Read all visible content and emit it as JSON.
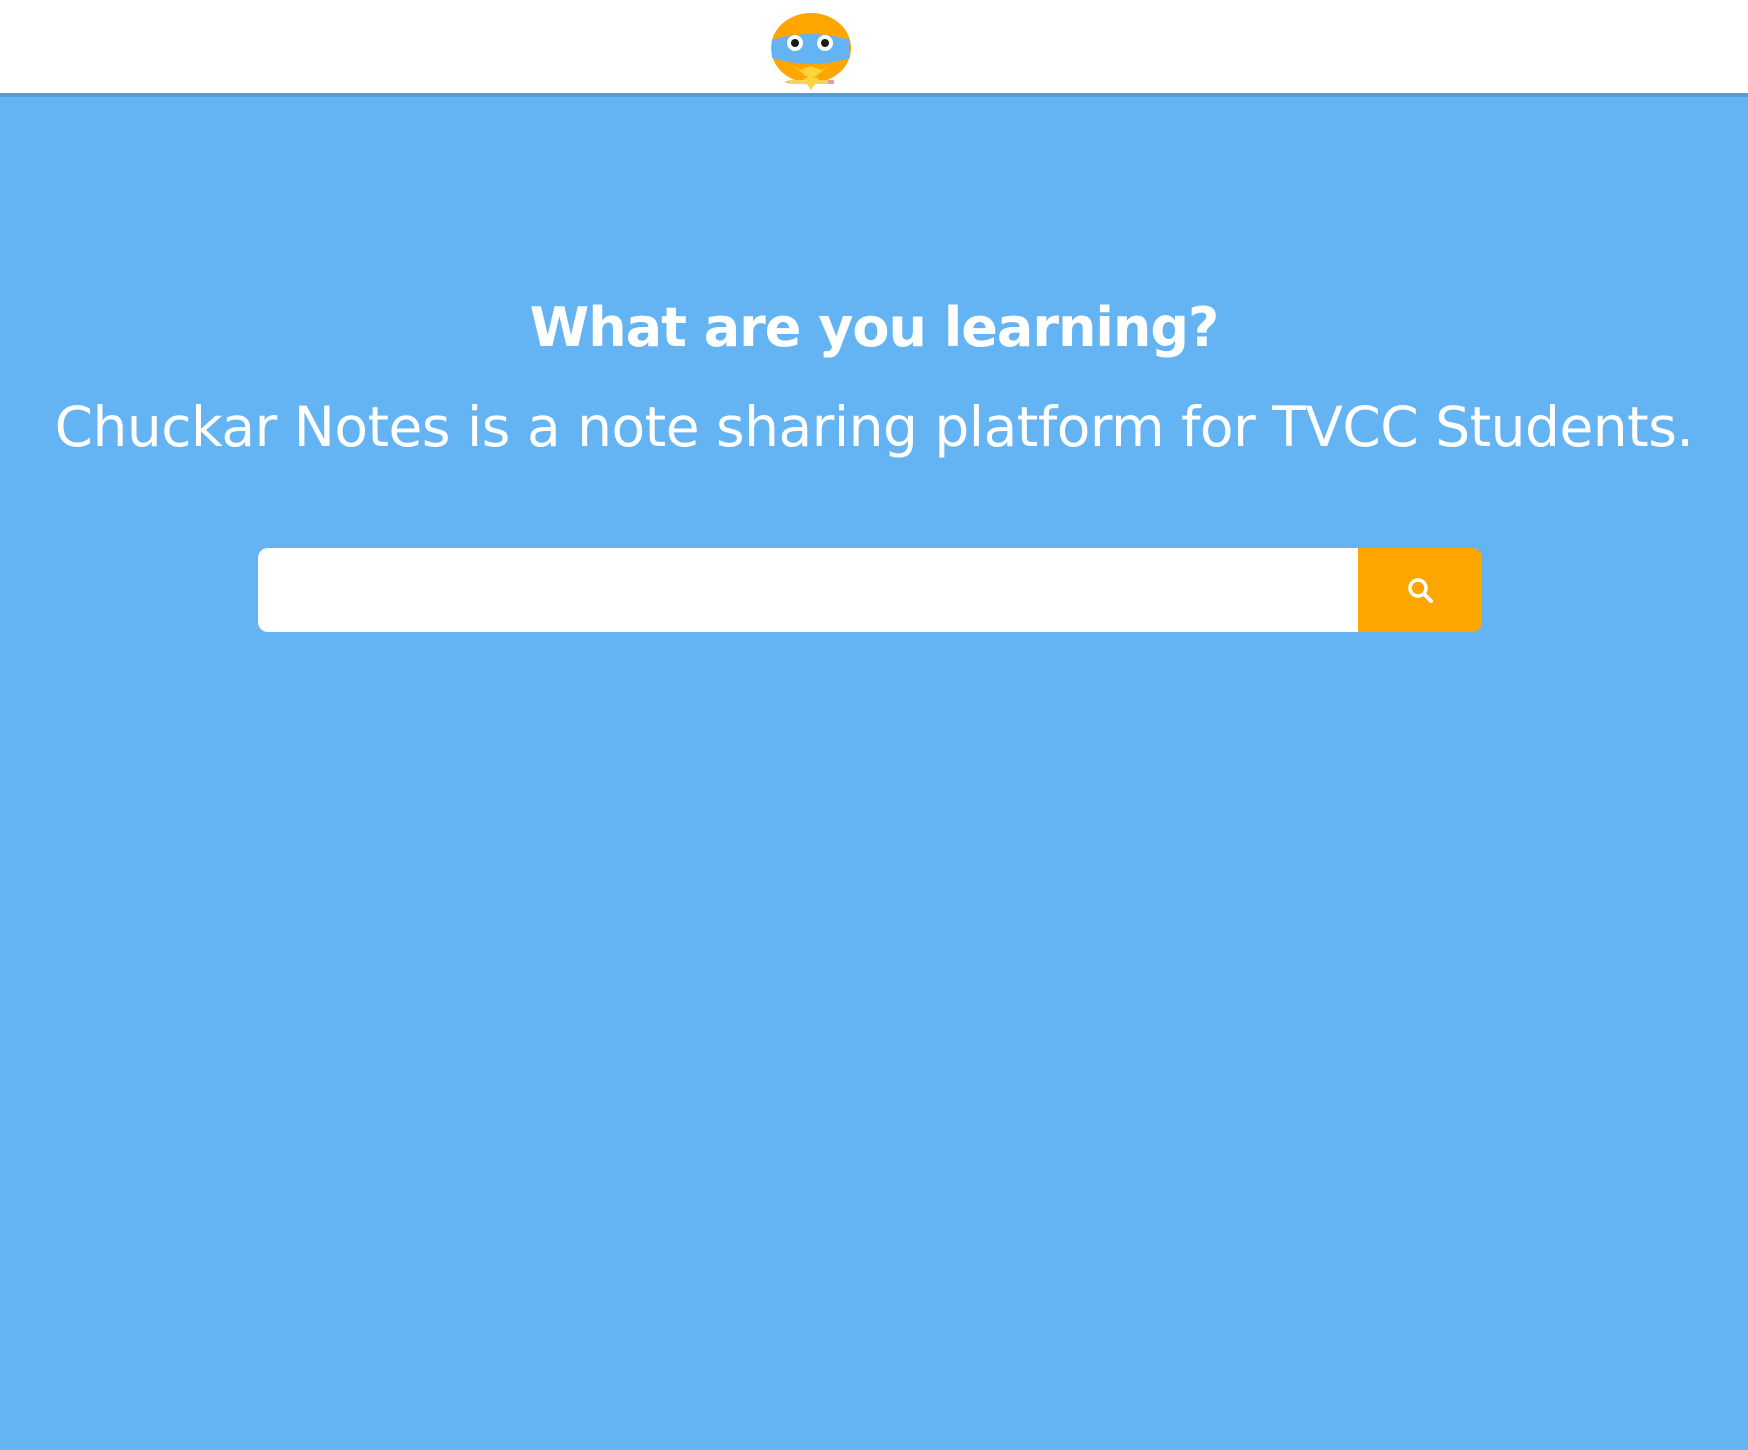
{
  "brand": {
    "logo_icon": "chuckar-bird-mascot-icon",
    "colors": {
      "primary_blue": "#64b4f4",
      "accent_orange": "#ffa500",
      "header_border": "#4c9fe3"
    }
  },
  "hero": {
    "headline": "What are you learning?",
    "tagline": "Chuckar Notes is a note sharing platform for TVCC Students."
  },
  "search": {
    "value": "",
    "placeholder": "",
    "button_icon": "search-icon"
  }
}
